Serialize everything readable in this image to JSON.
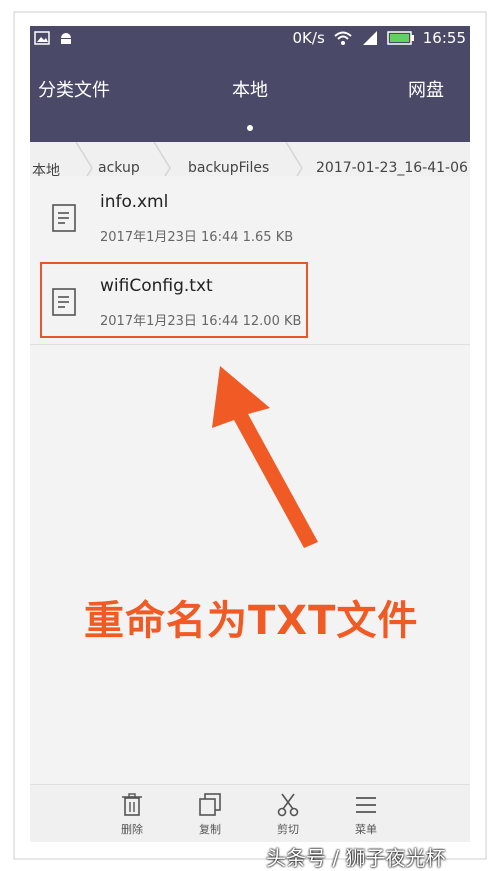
{
  "status_bar": {
    "speed": "0K/s",
    "time": "16:55"
  },
  "tabs": [
    {
      "label": "分类文件"
    },
    {
      "label": "本地"
    },
    {
      "label": "网盘"
    }
  ],
  "breadcrumb": [
    "本地",
    "ackup",
    "backupFiles",
    "2017-01-23_16-41-06"
  ],
  "files": [
    {
      "name": "info.xml",
      "meta": "2017年1月23日 16:44 1.65 KB"
    },
    {
      "name": "wifiConfig.txt",
      "meta": "2017年1月23日 16:44 12.00 KB"
    }
  ],
  "annotation": "重命名为TXT文件",
  "toolbar": [
    {
      "label": "删除",
      "icon": "trash-icon"
    },
    {
      "label": "复制",
      "icon": "copy-icon"
    },
    {
      "label": "剪切",
      "icon": "scissors-icon"
    },
    {
      "label": "菜单",
      "icon": "menu-icon"
    }
  ],
  "watermark": "头条号 / 狮子夜光杯",
  "colors": {
    "header": "#4a4a68",
    "annotation": "#f05a24",
    "highlight_border": "#e8572a"
  }
}
